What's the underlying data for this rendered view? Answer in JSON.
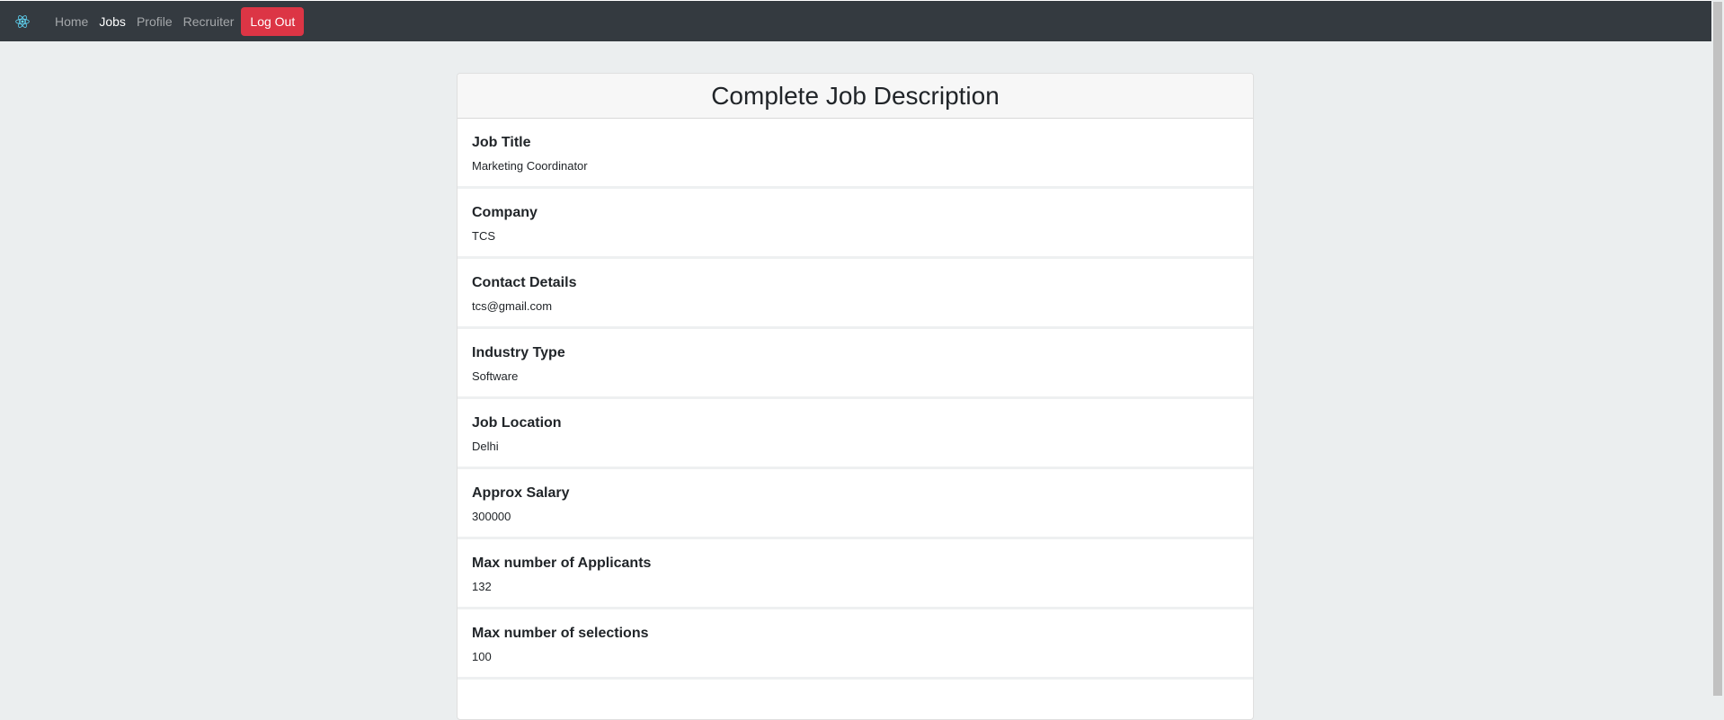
{
  "nav": {
    "brand_icon": "react-atom-icon",
    "links": [
      "Home",
      "Jobs",
      "Profile",
      "Recruiter"
    ],
    "active": "Jobs",
    "logout_label": "Log Out",
    "logout_color": "#dc3545",
    "bar_color": "#343a40"
  },
  "card": {
    "title": "Complete Job Description",
    "fields": [
      {
        "label": "Job Title",
        "value": "Marketing Coordinator"
      },
      {
        "label": "Company",
        "value": "TCS"
      },
      {
        "label": "Contact Details",
        "value": "tcs@gmail.com"
      },
      {
        "label": "Industry Type",
        "value": "Software"
      },
      {
        "label": "Job Location",
        "value": "Delhi"
      },
      {
        "label": "Approx Salary",
        "value": "300000"
      },
      {
        "label": "Max number of Applicants",
        "value": "132"
      },
      {
        "label": "Max number of selections",
        "value": "100"
      }
    ]
  }
}
